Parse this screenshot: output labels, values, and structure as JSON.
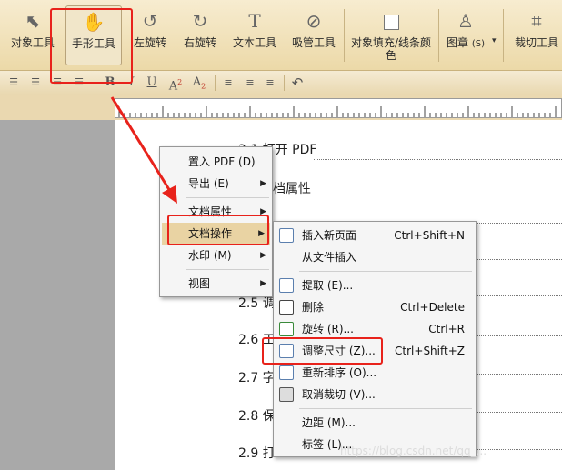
{
  "toolbar": {
    "items": [
      {
        "label": "对象工具",
        "icon": "pointer-icon"
      },
      {
        "label": "手形工具",
        "icon": "hand-icon"
      },
      {
        "label": "左旋转",
        "icon": "rotate-left-icon"
      },
      {
        "label": "右旋转",
        "icon": "rotate-right-icon"
      },
      {
        "label": "文本工具",
        "icon": "text-tool-icon"
      },
      {
        "label": "吸管工具",
        "icon": "eyedropper-icon"
      },
      {
        "label_line1": "对象填充/线条颜",
        "label_line2": "色",
        "icon": "fill-color-icon"
      },
      {
        "label": "图章",
        "shortcut": "(S)",
        "icon": "stamp-icon"
      },
      {
        "label": "裁切工具",
        "icon": "crop-icon"
      }
    ],
    "dropdown_glyph": "▾"
  },
  "formatbar": {
    "bold": "B",
    "italic": "I",
    "underline": "U",
    "superscript_base": "A",
    "superscript_mark": "2",
    "subscript_base": "A",
    "subscript_mark": "2",
    "undo_glyph": "↶"
  },
  "document": {
    "lines": [
      "2.1 打开 PDF",
      "档属性",
      "2.5 调",
      "2.6 工",
      "2.7 字",
      "2.8 保",
      "2.9 打"
    ]
  },
  "context_menu": {
    "items": [
      {
        "label": "置入 PDF (D)",
        "submenu": false
      },
      {
        "label": "导出 (E)",
        "submenu": true
      },
      {
        "label": "文档属性",
        "submenu": true
      },
      {
        "label": "文档操作",
        "submenu": true,
        "highlighted": true
      },
      {
        "label": "水印 (M)",
        "submenu": true
      },
      {
        "label": "视图",
        "submenu": true
      }
    ],
    "arrow_glyph": "▶"
  },
  "submenu": {
    "items": [
      {
        "label": "插入新页面",
        "shortcut": "Ctrl+Shift+N",
        "icon": "insert-page-icon"
      },
      {
        "label": "从文件插入",
        "shortcut": "",
        "icon": ""
      },
      {
        "label": "提取 (E)...",
        "shortcut": "",
        "icon": "extract-icon"
      },
      {
        "label": "删除",
        "shortcut": "Ctrl+Delete",
        "icon": "delete-page-icon"
      },
      {
        "label": "旋转 (R)...",
        "shortcut": "Ctrl+R",
        "icon": "rotate-page-icon"
      },
      {
        "label": "调整尺寸 (Z)...",
        "shortcut": "Ctrl+Shift+Z",
        "icon": "resize-page-icon"
      },
      {
        "label": "重新排序 (O)...",
        "shortcut": "",
        "icon": "reorder-icon"
      },
      {
        "label": "取消裁切 (V)...",
        "shortcut": "",
        "icon": "uncrop-icon"
      },
      {
        "label": "边距 (M)...",
        "shortcut": "",
        "icon": ""
      },
      {
        "label": "标签 (L)...",
        "shortcut": "",
        "icon": ""
      }
    ]
  },
  "watermark": "https://blog.csdn.net/qq_...",
  "colors": {
    "accent_red": "#e8221b",
    "toolbar_bg": "#ecd9a8",
    "menu_highlight": "#e9d3a3"
  }
}
